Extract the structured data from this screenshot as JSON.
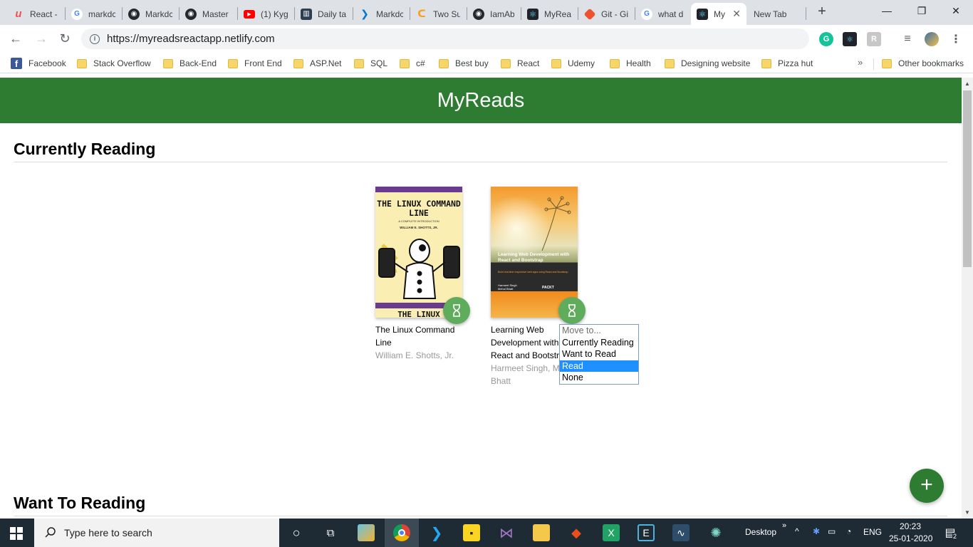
{
  "browser": {
    "tabs": [
      {
        "title": "React -",
        "icon": "udemy-icon",
        "color": "#ec5252"
      },
      {
        "title": "markdc",
        "icon": "google-icon",
        "color": "#4285f4"
      },
      {
        "title": "Markdc",
        "icon": "github-icon",
        "color": "#24292e"
      },
      {
        "title": "Master",
        "icon": "github-icon",
        "color": "#24292e"
      },
      {
        "title": "(1) Kyg",
        "icon": "youtube-icon",
        "color": "#ff0000"
      },
      {
        "title": "Daily ta",
        "icon": "trello-icon",
        "color": "#2c3e50"
      },
      {
        "title": "Markdc",
        "icon": "vscode-icon",
        "color": "#0078d4"
      },
      {
        "title": "Two Su",
        "icon": "leetcode-icon",
        "color": "#f89f1b"
      },
      {
        "title": "IamAbl",
        "icon": "github-icon",
        "color": "#24292e"
      },
      {
        "title": "MyRea",
        "icon": "react-icon",
        "color": "#20232a"
      },
      {
        "title": "Git - Gi",
        "icon": "git-icon",
        "color": "#f05032"
      },
      {
        "title": "what d",
        "icon": "google-icon",
        "color": "#4285f4"
      },
      {
        "title": "My",
        "icon": "react-icon",
        "color": "#20232a",
        "active": true
      },
      {
        "title": "New Tab",
        "icon": "",
        "color": ""
      }
    ],
    "new_tab": "+",
    "minimize": "—",
    "restore": "❐",
    "close": "✕",
    "url": "https://myreadsreactapp.netlify.com"
  },
  "bookmarks": [
    {
      "label": "Facebook",
      "icon": "facebook-icon"
    },
    {
      "label": "Stack Overflow",
      "icon": "folder-icon"
    },
    {
      "label": "Back-End",
      "icon": "folder-icon"
    },
    {
      "label": "Front End",
      "icon": "folder-icon"
    },
    {
      "label": "ASP.Net",
      "icon": "folder-icon"
    },
    {
      "label": "SQL",
      "icon": "folder-icon"
    },
    {
      "label": "c#",
      "icon": "folder-icon"
    },
    {
      "label": "Best buy",
      "icon": "folder-icon"
    },
    {
      "label": "React",
      "icon": "folder-icon"
    },
    {
      "label": "Udemy",
      "icon": "folder-icon"
    },
    {
      "label": "Health",
      "icon": "folder-icon"
    },
    {
      "label": "Designing website",
      "icon": "folder-icon"
    },
    {
      "label": "Pizza hut",
      "icon": "folder-icon"
    }
  ],
  "bookmarks_more": "»",
  "other_bookmarks": "Other bookmarks",
  "app": {
    "title": "MyReads",
    "accent": "#2e7c31",
    "shelves": [
      {
        "title": "Currently Reading",
        "books": [
          {
            "title": "The Linux Command Line",
            "author": "William E. Shotts, Jr.",
            "cover_title": "THE LINUX COMMAND LINE",
            "cover_subtitle": "A COMPLETE INTRODUCTION",
            "cover_author": "WILLIAM E. SHOTTS, JR.",
            "cover_footer": "THE LINUX"
          },
          {
            "title": "Learning Web Development with React and Bootstrap",
            "author": "Harmeet Singh, Mehul Bhatt",
            "cover_title": "Learning Web Development with React and Bootstrap",
            "cover_subtitle": "Build real-time responsive web apps using React and Bootstrap",
            "cover_author": "Harmeet Singh\nMehul Bhatt",
            "cover_brand": "PACKT"
          }
        ]
      },
      {
        "title": "Want To Reading"
      }
    ],
    "move_menu": {
      "options": [
        "Move to...",
        "Currently Reading",
        "Want to Read",
        "Read",
        "None"
      ],
      "selected": "Read"
    },
    "add_button": "+"
  },
  "taskbar": {
    "search_placeholder": "Type here to search",
    "desktop_label": "Desktop",
    "desktop_chevron": "»",
    "language": "ENG",
    "time": "20:23",
    "date": "25-01-2020",
    "notification_count": "2"
  }
}
